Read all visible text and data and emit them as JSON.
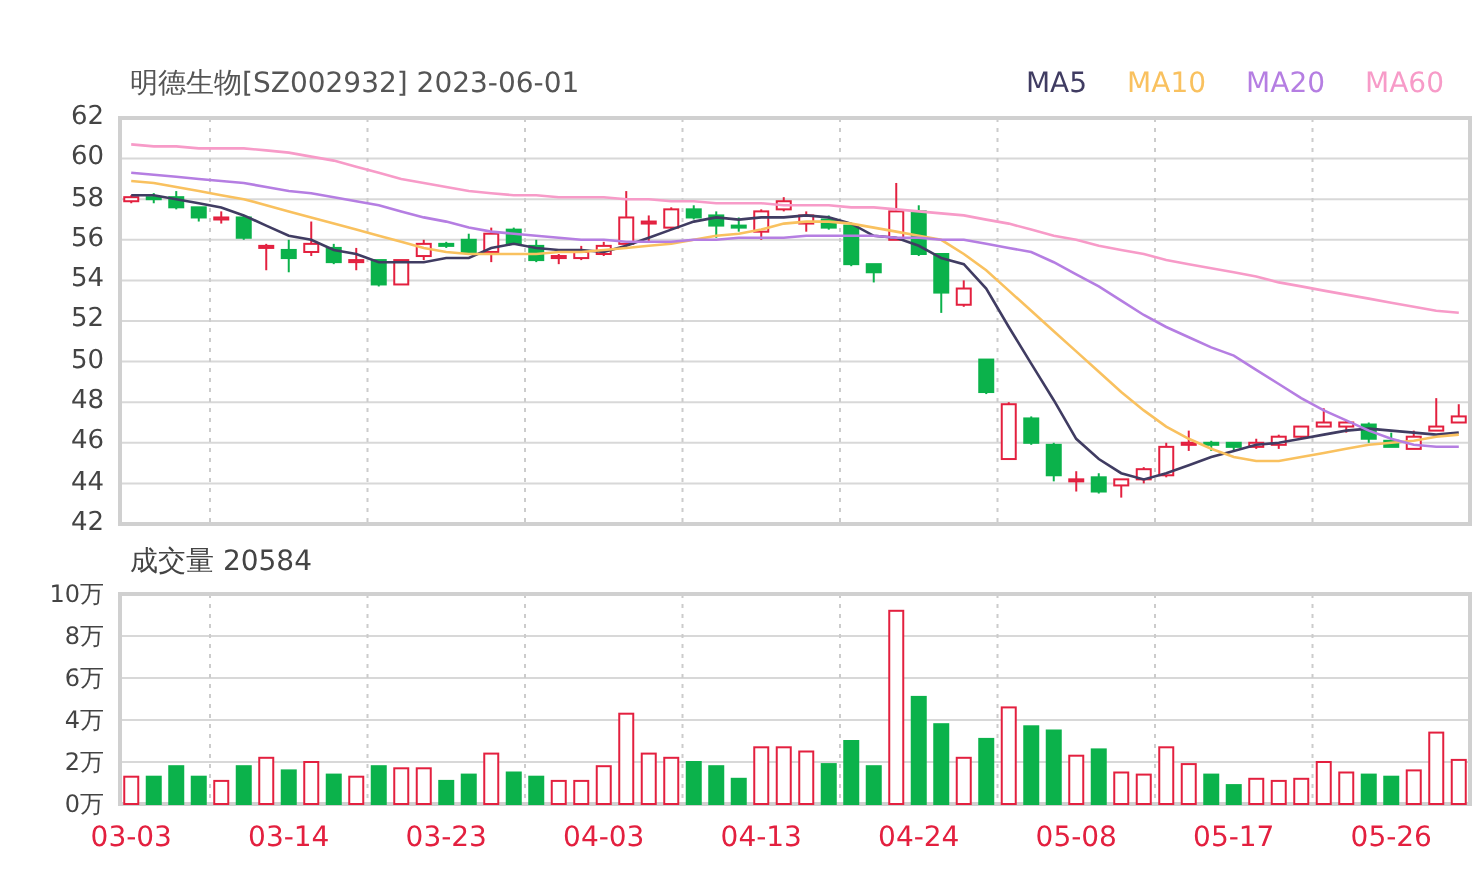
{
  "header": {
    "title": "明德生物[SZ002932] 2023-06-01"
  },
  "price": {
    "chart_data": {
      "type": "candlestick",
      "grid": true,
      "ylim": [
        42,
        62
      ],
      "yticks": [
        42,
        44,
        46,
        48,
        50,
        52,
        54,
        56,
        58,
        60,
        62
      ],
      "ohlc": [
        [
          57.9,
          58.2,
          57.8,
          58.1
        ],
        [
          58.1,
          58.3,
          57.8,
          58.0
        ],
        [
          58.1,
          58.4,
          57.5,
          57.6
        ],
        [
          57.6,
          57.6,
          56.9,
          57.1
        ],
        [
          57.0,
          57.4,
          56.8,
          57.1
        ],
        [
          57.1,
          57.2,
          56.0,
          56.1
        ],
        [
          55.6,
          55.8,
          54.5,
          55.7
        ],
        [
          55.5,
          56.0,
          54.4,
          55.1
        ],
        [
          55.4,
          56.9,
          55.2,
          55.8
        ],
        [
          55.6,
          55.8,
          54.8,
          54.9
        ],
        [
          54.9,
          55.6,
          54.5,
          55.0
        ],
        [
          55.0,
          55.0,
          53.7,
          53.8
        ],
        [
          53.8,
          55.0,
          53.8,
          55.0
        ],
        [
          55.2,
          56.0,
          55.0,
          55.8
        ],
        [
          55.8,
          55.9,
          55.6,
          55.7
        ],
        [
          56.0,
          56.3,
          55.3,
          55.4
        ],
        [
          55.4,
          56.6,
          54.9,
          56.3
        ],
        [
          56.5,
          56.6,
          55.8,
          55.8
        ],
        [
          55.7,
          56.0,
          54.9,
          55.0
        ],
        [
          55.1,
          55.3,
          54.8,
          55.2
        ],
        [
          55.1,
          55.7,
          55.0,
          55.4
        ],
        [
          55.3,
          55.9,
          55.2,
          55.7
        ],
        [
          55.8,
          58.4,
          55.7,
          57.1
        ],
        [
          56.8,
          57.2,
          55.9,
          56.9
        ],
        [
          56.6,
          57.6,
          56.5,
          57.5
        ],
        [
          57.5,
          57.7,
          57.0,
          57.1
        ],
        [
          57.2,
          57.4,
          56.1,
          56.7
        ],
        [
          56.7,
          57.1,
          56.4,
          56.6
        ],
        [
          56.4,
          57.5,
          56.0,
          57.4
        ],
        [
          57.5,
          58.1,
          57.4,
          57.9
        ],
        [
          56.8,
          57.4,
          56.4,
          57.2
        ],
        [
          57.0,
          57.2,
          56.5,
          56.6
        ],
        [
          56.7,
          56.7,
          54.7,
          54.8
        ],
        [
          54.8,
          54.8,
          53.9,
          54.4
        ],
        [
          56.0,
          58.8,
          56.0,
          57.4
        ],
        [
          57.4,
          57.7,
          55.2,
          55.3
        ],
        [
          55.3,
          55.3,
          52.4,
          53.4
        ],
        [
          52.8,
          54.0,
          52.7,
          53.6
        ],
        [
          50.1,
          50.1,
          48.4,
          48.5
        ],
        [
          45.2,
          48.0,
          45.2,
          47.9
        ],
        [
          47.2,
          47.3,
          45.9,
          46.0
        ],
        [
          45.9,
          46.0,
          44.1,
          44.4
        ],
        [
          44.1,
          44.6,
          43.6,
          44.2
        ],
        [
          44.3,
          44.5,
          43.5,
          43.6
        ],
        [
          43.9,
          44.2,
          43.3,
          44.2
        ],
        [
          44.2,
          44.8,
          44.0,
          44.7
        ],
        [
          44.4,
          46.0,
          44.3,
          45.8
        ],
        [
          45.9,
          46.6,
          45.6,
          46.0
        ],
        [
          46.0,
          46.1,
          45.6,
          45.9
        ],
        [
          46.0,
          46.0,
          45.6,
          45.8
        ],
        [
          45.8,
          46.2,
          45.7,
          46.0
        ],
        [
          45.9,
          46.4,
          45.7,
          46.3
        ],
        [
          46.3,
          46.8,
          46.2,
          46.8
        ],
        [
          46.8,
          47.7,
          46.8,
          47.0
        ],
        [
          46.8,
          47.1,
          46.5,
          47.0
        ],
        [
          46.9,
          47.0,
          46.0,
          46.2
        ],
        [
          46.1,
          46.5,
          45.8,
          45.8
        ],
        [
          45.7,
          46.6,
          45.7,
          46.3
        ],
        [
          46.6,
          48.2,
          46.6,
          46.8
        ],
        [
          47.0,
          47.9,
          47.0,
          47.3
        ]
      ],
      "series": [
        {
          "name": "MA5",
          "type": "line",
          "color": "#403c62",
          "values": [
            58.2,
            58.2,
            58.0,
            57.8,
            57.6,
            57.2,
            56.7,
            56.2,
            56.0,
            55.5,
            55.3,
            54.9,
            54.9,
            54.9,
            55.1,
            55.1,
            55.6,
            55.8,
            55.6,
            55.5,
            55.5,
            55.4,
            55.7,
            56.1,
            56.5,
            56.9,
            57.1,
            57.0,
            57.1,
            57.1,
            57.2,
            57.1,
            56.8,
            56.2,
            56.1,
            55.7,
            55.1,
            54.8,
            53.6,
            51.7,
            49.9,
            48.1,
            46.2,
            45.2,
            44.5,
            44.2,
            44.5,
            44.9,
            45.3,
            45.6,
            45.9,
            46.0,
            46.2,
            46.4,
            46.6,
            46.7,
            46.6,
            46.5,
            46.4,
            46.5
          ]
        },
        {
          "name": "MA10",
          "type": "line",
          "color": "#f9c15f",
          "values": [
            58.9,
            58.8,
            58.6,
            58.4,
            58.2,
            58.0,
            57.7,
            57.4,
            57.1,
            56.8,
            56.5,
            56.2,
            55.9,
            55.6,
            55.4,
            55.3,
            55.3,
            55.3,
            55.3,
            55.4,
            55.4,
            55.5,
            55.6,
            55.7,
            55.8,
            56.0,
            56.2,
            56.3,
            56.5,
            56.8,
            56.9,
            56.9,
            56.8,
            56.6,
            56.4,
            56.2,
            56.0,
            55.3,
            54.5,
            53.5,
            52.5,
            51.5,
            50.5,
            49.5,
            48.5,
            47.6,
            46.8,
            46.2,
            45.7,
            45.3,
            45.1,
            45.1,
            45.3,
            45.5,
            45.7,
            45.9,
            46.0,
            46.1,
            46.3,
            46.4
          ]
        },
        {
          "name": "MA20",
          "type": "line",
          "color": "#b57ee2",
          "values": [
            59.3,
            59.2,
            59.1,
            59.0,
            58.9,
            58.8,
            58.6,
            58.4,
            58.3,
            58.1,
            57.9,
            57.7,
            57.4,
            57.1,
            56.9,
            56.6,
            56.4,
            56.3,
            56.2,
            56.1,
            56.0,
            56.0,
            55.9,
            55.9,
            55.9,
            56.0,
            56.0,
            56.1,
            56.1,
            56.1,
            56.2,
            56.2,
            56.2,
            56.2,
            56.1,
            56.1,
            56.0,
            56.0,
            55.8,
            55.6,
            55.4,
            54.9,
            54.3,
            53.7,
            53.0,
            52.3,
            51.7,
            51.2,
            50.7,
            50.3,
            49.6,
            48.9,
            48.2,
            47.6,
            47.1,
            46.6,
            46.2,
            45.9,
            45.8,
            45.8
          ]
        },
        {
          "name": "MA60",
          "type": "line",
          "color": "#f79bc8",
          "values": [
            60.7,
            60.6,
            60.6,
            60.5,
            60.5,
            60.5,
            60.4,
            60.3,
            60.1,
            59.9,
            59.6,
            59.3,
            59.0,
            58.8,
            58.6,
            58.4,
            58.3,
            58.2,
            58.2,
            58.1,
            58.1,
            58.1,
            58.0,
            58.0,
            57.9,
            57.9,
            57.8,
            57.8,
            57.8,
            57.7,
            57.7,
            57.7,
            57.6,
            57.6,
            57.5,
            57.4,
            57.3,
            57.2,
            57.0,
            56.8,
            56.5,
            56.2,
            56.0,
            55.7,
            55.5,
            55.3,
            55.0,
            54.8,
            54.6,
            54.4,
            54.2,
            53.9,
            53.7,
            53.5,
            53.3,
            53.1,
            52.9,
            52.7,
            52.5,
            52.4
          ]
        }
      ]
    }
  },
  "volume": {
    "label": "成交量 20584",
    "chart_data": {
      "type": "bar",
      "grid": true,
      "ylim": [
        0,
        10
      ],
      "yticks": [
        {
          "value": 0,
          "label": "0万"
        },
        {
          "value": 2,
          "label": "2万"
        },
        {
          "value": 4,
          "label": "4万"
        },
        {
          "value": 6,
          "label": "6万"
        },
        {
          "value": 8,
          "label": "8万"
        },
        {
          "value": 10,
          "label": "10万"
        }
      ],
      "categories": [
        "03-03",
        null,
        null,
        null,
        null,
        null,
        null,
        "03-14",
        null,
        null,
        null,
        null,
        null,
        null,
        "03-23",
        null,
        null,
        null,
        null,
        null,
        null,
        "04-03",
        null,
        null,
        null,
        null,
        null,
        null,
        "04-13",
        null,
        null,
        null,
        null,
        null,
        null,
        "04-24",
        null,
        null,
        null,
        null,
        null,
        null,
        "05-08",
        null,
        null,
        null,
        null,
        null,
        null,
        "05-17",
        null,
        null,
        null,
        null,
        null,
        null,
        "05-26",
        null,
        null,
        null
      ],
      "values": [
        1.3,
        1.3,
        1.8,
        1.3,
        1.1,
        1.8,
        2.2,
        1.6,
        2.0,
        1.4,
        1.3,
        1.8,
        1.7,
        1.7,
        1.1,
        1.4,
        2.4,
        1.5,
        1.3,
        1.1,
        1.1,
        1.8,
        4.3,
        2.4,
        2.2,
        2.0,
        1.8,
        1.2,
        2.7,
        2.7,
        2.5,
        1.9,
        3.0,
        1.8,
        9.2,
        5.1,
        3.8,
        2.2,
        3.1,
        4.6,
        3.7,
        3.5,
        2.3,
        2.6,
        1.5,
        1.4,
        2.7,
        1.9,
        1.4,
        0.9,
        1.2,
        1.1,
        1.2,
        2.0,
        1.5,
        1.4,
        1.3,
        1.6,
        3.4,
        2.1
      ]
    }
  }
}
